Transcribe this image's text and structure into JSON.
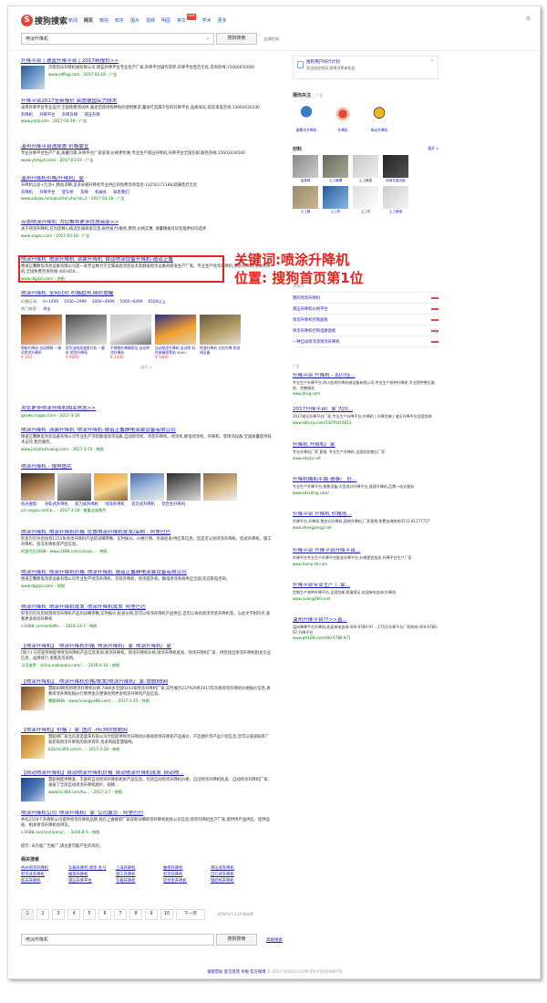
{
  "header": {
    "logo_letter": "S",
    "logo_text": "搜狗搜索",
    "nav": [
      "新闻",
      "网页",
      "微信",
      "知乎",
      "图片",
      "视频",
      "明医",
      "英文",
      "学术",
      "更多"
    ],
    "nav_current": "网页",
    "nav_new_badge": "new",
    "search_query": "喷涂升降机",
    "search_button": "搜狗搜索",
    "search_option": "全部时间",
    "settings_icon": "gear-icon"
  },
  "results": [
    {
      "title": "升降平台 | 德蓝升降平台 | 2017新报价>>",
      "desc": "济南凯乐升降机械有限公司,德蓝升降平台专业生产厂家,升降平台操作简单,升降平台售后无忧,咨询热线:15066650000",
      "url": "www.sdfhgj.com - 2017-03-18 - 广告",
      "thumb": "a"
    },
    {
      "title": "升降平台2017全新报价 荣图德国实力技术",
      "desc": "采用升降平台专业设计,全国免费测试供,满足您现场各种地形使用要求,量身打造属于您的升降平台,品质保证,欢迎来电咨询:13964030240",
      "sub": [
        "升降机",
        "升降平台",
        "升降货梯",
        "液压升降"
      ],
      "url": "www.jnjdy.com - 2017-03-18 - 广告"
    },
    {
      "title": "温州升降平台选择惠  价格便宜",
      "desc": "专业升降平台生产厂家,质量可靠,升降平台广家直销,价格更优惠,专业生产液压升降机,升降平台全国包邮,服务热线:15662430566",
      "url": "www.yhdsjpt.com/ - 2017-03-19 - 广告"
    },
    {
      "title": "温州升降机价格/升降机厂家",
      "desc": "升降机认准+九池+,精益求精,追求卓越升降机专业供应商免费咨询电话:13256172188,圆满售后无忧",
      "sub": [
        "升降机",
        "升降平台",
        "登车桥",
        "货梯",
        "机械式",
        "联系我们"
      ],
      "url": "www.sdjxjw.com/plusfrel.php?id=2 - 2017-03-18 - 广告"
    },
    {
      "title": "点击喷涂升降机_为您推荐更多优质商家>>",
      "desc": "关于喷涂升降机,已为您精心挑选优质商家信息,省时省力(服务,费用,价格实惠, 请量精推有好您能更好的选择",
      "url": "www.sogou.com - 2017-03-18 - 广告"
    }
  ],
  "highlight_result": {
    "title": "喷涂升降机_喷涂升降机_涂装升降机_自动喷涂设备升降机-德道正馨",
    "desc": "德道正馨静电涂装设备有限公司是一家专业致力于全属表面涂装技术及静电喷涂设备的研发生产厂家。专业生产喷涂升降机,涂装升降机,喷涂升降机,全国免费咨询热线:400-850...",
    "url": "www.dqjzjd.com/ - 快照"
  },
  "callout": {
    "line1": "关键词:喷涂升降机",
    "line2": "位置: 搜狗首页第1位"
  },
  "price_result": {
    "title": "喷涂升降机_全网比价,价格趋势,降价提醒",
    "filters_label": "价格区间:",
    "filters": [
      "0~1499",
      "1500~2999",
      "3000~4999",
      "5000~6499",
      "6500以上"
    ],
    "shops_label": "热门商家:",
    "shops": [
      "淘宝"
    ],
    "items": [
      {
        "cap": "喷粉升降机 自动喷粉 一体化喷涂升降机",
        "price": "¥ 100"
      },
      {
        "cap": "豪华油电双速直升机 一整机 喷涂升降机",
        "price": "¥ 6000"
      },
      {
        "cap": "不锈钢升降精密设 自动喷涂升降机",
        "price": "¥ 1200"
      },
      {
        "cap": "自动喷涂升降机 自动喷 机往来精密等机 4000",
        "price": "¥ 5800"
      },
      {
        "cap": "喷漆升降机 立柱升降 机流线设备",
        "price": ""
      }
    ],
    "fold": "展开 ∨"
  },
  "sogou_link": {
    "title": "浏览更多喷涂升降机相关信息>>",
    "url": "gouwu.sogou.com - 2017-3-18"
  },
  "organic": [
    {
      "title": "喷涂升降机_涂装升降机_喷涂升降机-德道正馨静电涂装设备有限公司",
      "desc": "德道正馨静电涂装设备有限公司专业生产涂装静电喷涂设备,自动喷涂机、涂装升降机、喷涂机,静电喷涂机、升降机、等喷涂设备,全国质量提供技术支持,售后服务。",
      "url": "www.jinlaifuzhuang.com/ - 2017-3-10 - 快照"
    },
    {
      "title": "喷涂升降机 - 搜狗图片",
      "image_row": 7,
      "sub": [
        "机光搜索:",
        "导轨式升降机",
        "剪刀式升降机",
        "喷涂升降机",
        "剪叉式升降机",
        "铝合金升降机"
      ],
      "url": "pic.sogou.com/p... - 2017-3-18 - 查看全部图片"
    },
    {
      "title": "喷涂升降机_喷涂升降机价格_优惠喷涂升降机批发/采购 - 阿里巴巴",
      "desc": "阿里巴巴为您找到1155条喷涂升降机产品的详细参数、实时报价、价格行情、优质批发/供应等信息。您还可以找喷涂升降机、剪式升降机、施工升降机、剪叉升降机等产品信息。",
      "url": "阿里巴巴1688 - www.1688.com/chanp... - 快照"
    },
    {
      "title": "喷涂升降机_喷涂升降机价格_喷涂升降机_德道正馨静电涂装设备有限公司",
      "desc": "德道正馨静电涂装设备有限公司专业生产喷涂升降机、涂装升降机、喷涂提升机、静电喷涂系统供应全国,欢迎来电咨询。",
      "url": "www.dqjzjd.com/ - 快照"
    },
    {
      "title": "喷涂升降机_喷涂升降机批发_喷涂升降机批发_阿里巴巴",
      "desc": "阿里巴巴为您找到喷涂升降机产品的详细参数,实时报价,批发价格,您可以喷涂升降机产品供应,还可以再找喷涂涂装升降机等。与此文字相符点,查看更多喷涂升降机",
      "url": "s.1688.com/selloffe... - 2016-12-7 - 快照"
    },
    {
      "title": "【喷涂升降机】_喷涂升降机价格_喷涂升降机厂家_喷涂升降机厂家",
      "desc": "[简介] 马可波罗网提供喷涂升降机产品信息查询,喷涂升降机、喷涂升降机价格,喷涂升降机批发、喷涂升降机厂家、供您找出喷涂升降机相关企业信息、品牌排行,查看及可采购。",
      "url": "马可波罗 - china.makepolo.com/... - 2016-6-10 - 快照"
    },
    {
      "title": "【喷涂升降机】_喷涂升降机价格/批发/喷涂升降机厂家-慧聪88网",
      "desc": "慧聪88网找到喷涂升降机价格:7880多全国9143家喷涂升降机厂家,实时展示237929条2017年优质喷涂升降机价格报价信息,查看喷涂升降机报价行情更加方便请找到更多喷涂升降机产品信息。",
      "url": "慧聪88网 - www.huangye88.com/... - 2017-1-25 - 快照",
      "thumb": "b"
    },
    {
      "title": "【喷涂升降机】价格_厂家_图片 -Hc360慧聪网",
      "desc": "慧聪网厂家北京恩诺盛荣有限公司为您提供喷涂升降机价格和喷涂升降机产品报价、产品图片等产品介绍信息,您可以直接联系厂家获取喷涂升降机的具体资料,找采购就是慧聪网。",
      "url": "b2b.hc360.com/s... - 2017-2-28 - 快照",
      "thumb": "c"
    },
    {
      "title": "【自动喷涂升降机】自动喷涂升降机价格_自动喷涂升降机批发_自动喷...",
      "desc": "慧聪网提供精准、丰富的自动喷涂升降机相关产品信息。包括自动喷涂升降机价格、自动喷涂升降机批发、自动喷涂升降机厂家,涵盖了全部自动喷涂升降机图片、规格...",
      "url": "www.hc360.com/hu... - 2017-3-7 - 快照",
      "thumb": "d"
    },
    {
      "title": "喷涂升降机公司_喷涂升降机厂家_公司黄页 - 阿里巴巴",
      "desc": "共有2518个升降机公司提供喷涂升降机品牌,找在上做搜索厂家获取详细喷涂升降机相关公司信息,喷涂升降机生产厂家,提供供产品供应、提供品质、相关喷涂升降机的供货。",
      "url": "s.1688.com/company/... - 2016-8-5 - 快照"
    }
  ],
  "notice": "提示: 未页面广告推广,请注意可能产生的风险。",
  "related": {
    "heading": "相关搜索",
    "items": [
      "杭州喷涂升降机",
      "车载升降机,喷涂,金马",
      "上海升降机",
      "曲桥升降机",
      "液压式升降机",
      "剪叉式升降机",
      "桶梁升降机",
      "施工升降机",
      "剪叉升降机",
      "自行式升降机",
      "航天升降机",
      "液压升降平台",
      "车载升降机",
      "铝合金升降机",
      "钢结构升降机"
    ]
  },
  "pager": {
    "pages": [
      "1",
      "2",
      "3",
      "4",
      "5",
      "6",
      "7",
      "8",
      "9",
      "10"
    ],
    "current": "1",
    "next": "下一页",
    "count": "找到约25,120条结果"
  },
  "bottom_search": {
    "query": "喷涂升降机",
    "button": "搜狗搜索",
    "advanced": "高级搜索"
  },
  "footer": {
    "links": "搜索帮助 意见反馈 举报 官方微博",
    "copyright": "© 2017 SOGOU.COM 京ICP证050897号"
  },
  "side": {
    "card": {
      "title": "搜狗用户除行计划",
      "desc": "发送描述错误,保障消费者权益",
      "close": "×"
    },
    "ent_title": "猜你关注",
    "ent_ad": "- 广告",
    "ents": [
      "曲臂式升降机",
      "升降机",
      "电动升降机"
    ],
    "mat_title": "材料",
    "mat_fold": "展开 ∨",
    "mats": [
      "金属网",
      "土工格栅",
      "土工格室",
      "彩钢瓦复合板",
      "土工膜",
      "土工布",
      "土工布",
      "土工格室"
    ],
    "rel_title": "关键词",
    "rel_items": [
      "我的喷涂升降机",
      "液压升降机价格平台",
      "喷涂升降机控制面板",
      "喷涂升降机控制电路面板",
      "一种自动喷涂漆喷涂升降机"
    ],
    "ad_label": "广告",
    "fold_label": "折叠",
    "ads": [
      {
        "title": "升降平台 升降机 - 四川佳...",
        "desc": "专业生产升降平台,四川佳昂升降机械设备有限公司,专业生产各种升降机,专业提供售后服务、完善服务",
        "url": "www.jfsxg.com"
      },
      {
        "title": "2017升降平台厂家 大同...",
        "desc": "2017液压升降平台厂家,专业生产升降平台,升降机 | 升降货梯 | 液压升降平台全国包邮",
        "url": "www.sdtcxjx.com/13076410653"
      },
      {
        "title": "升降机 升降机厂家",
        "desc": "专业升降机厂家 直销, 专业生产升降机,全国优质售后厂家",
        "url": "www.sdsjzx.net"
      },
      {
        "title": "升降机械和平面 德泰厂 价...",
        "desc": "专业生产升降平台,销售设备,大型进口升降平台,直接升降机,品牌一站式服务",
        "url": "www.sdsxding.com/"
      },
      {
        "title": "升降平台 升降机 价格低...",
        "desc": "升降平台,升降机,剪叉式升降机,直销升降机,厂家直销,免费咨询热线0531-81177727",
        "url": "www.shengjiangji.net"
      },
      {
        "title": "升降平台 升降平台升降平台...",
        "desc": "升降平台专业生产升降平台批发升降平台,价格便宜批发,升降平台生产厂家",
        "url": "www.tonny-sh.com"
      },
      {
        "title": "升降平台专业生产 厂家...",
        "desc": "定制生产各种升降平台,全国包邮,质量保证,欢迎来电咨询:升降机",
        "url": "www.jiuanjg360.com"
      },
      {
        "title": "温州升降平台??>>直...",
        "desc": "温州降降平台升降机,欢迎来电咨询:400-6786-97 ...170天升降平台厂家热线:400-6786-97,升降平台",
        "url": "www.ptt168.com/400-6786-971"
      }
    ]
  }
}
